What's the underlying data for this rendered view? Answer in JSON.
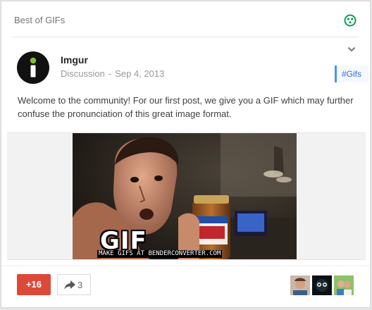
{
  "community": {
    "name": "Best of GIFs",
    "icon": "community-circle-icon"
  },
  "post": {
    "author": "Imgur",
    "category": "Discussion",
    "separator": "-",
    "date": "Sep 4, 2013",
    "hashtag": "#Gifs",
    "text": "Welcome to the community! For our first post, we give you a GIF which may further confuse the pronunciation of this great image format.",
    "media": {
      "badge": "GIF",
      "credit": "MAKE GIFS AT BENDERCONVERTER.COM"
    }
  },
  "actions": {
    "plus_label": "+16",
    "share_count": "3"
  },
  "colors": {
    "plus_red": "#db4a39",
    "hashtag_blue": "#4d90fe",
    "community_green": "#0f9d58"
  }
}
